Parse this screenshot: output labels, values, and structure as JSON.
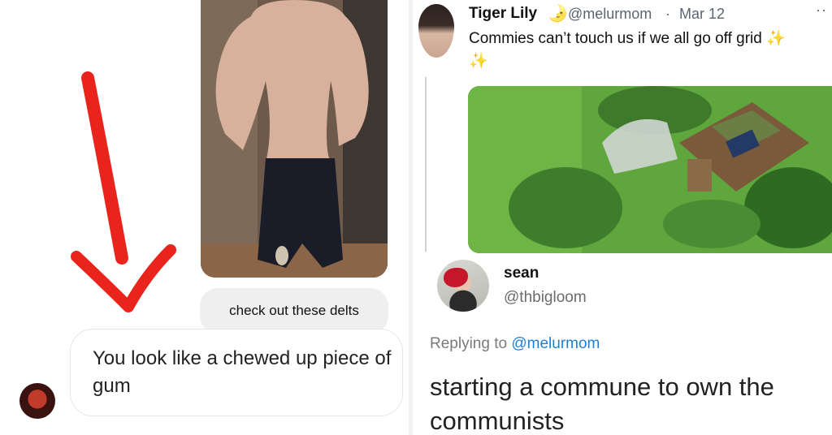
{
  "left_chat": {
    "sent_message": "check out these delts",
    "received_message": "You look like a chewed up piece of gum",
    "icons": {
      "photo": "shirtless-mirror-photo",
      "arrow": "red-arrow-icon",
      "avatar": "user-avatar"
    }
  },
  "tweet": {
    "author_name": "Tiger Lily",
    "author_emoji": "🌛",
    "handle": "@melurmom",
    "separator": "·",
    "date": "Mar 12",
    "more": "··",
    "text": "Commies can’t touch us if we all go off grid",
    "sparkle_1": "✨",
    "sparkle_2": "✨",
    "image": "aerial-homestead-photo"
  },
  "reply": {
    "author_name": "sean",
    "handle": "@thbigloom",
    "replying_label": "Replying to",
    "replying_handle": "@melurmom",
    "text": "starting a commune to own the communists"
  },
  "colors": {
    "arrow": "#e8241c",
    "link": "#1d7fd6",
    "bubble": "#efefef"
  }
}
